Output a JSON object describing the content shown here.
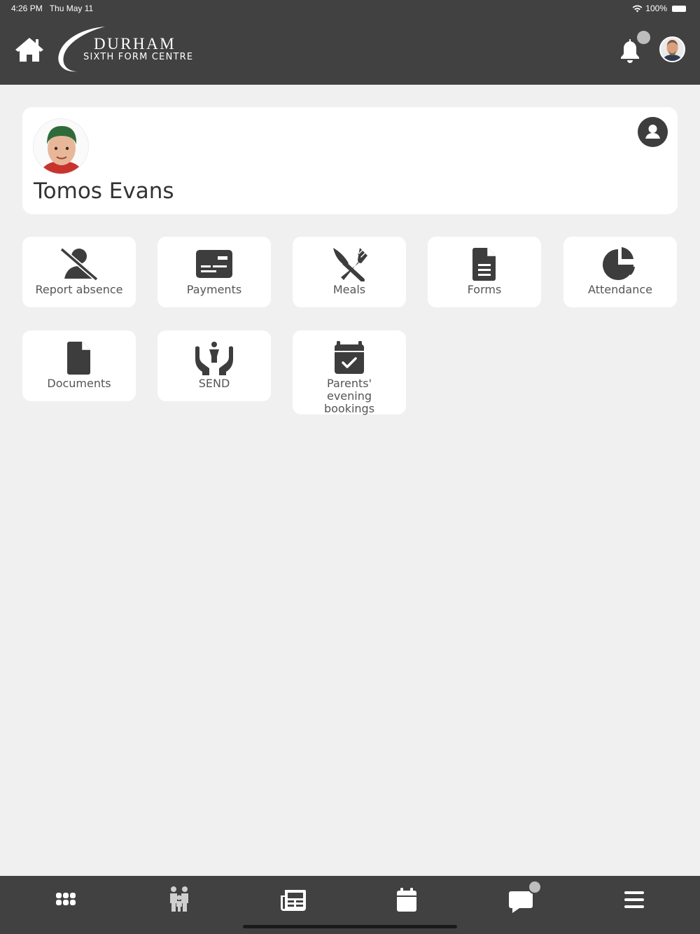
{
  "status_bar": {
    "time": "4:26 PM",
    "date": "Thu May 11",
    "battery": "100%"
  },
  "header": {
    "logo_title": "DURHAM",
    "logo_subtitle": "SIXTH FORM CENTRE",
    "icons": [
      "home-icon",
      "bell-icon",
      "user-avatar"
    ]
  },
  "profile": {
    "name": "Tomos Evans"
  },
  "tiles": [
    {
      "label": "Report absence",
      "icon": "user-slash-icon"
    },
    {
      "label": "Payments",
      "icon": "credit-card-icon"
    },
    {
      "label": "Meals",
      "icon": "utensils-icon"
    },
    {
      "label": "Forms",
      "icon": "document-text-icon"
    },
    {
      "label": "Attendance",
      "icon": "pie-chart-icon"
    },
    {
      "label": "Documents",
      "icon": "file-icon"
    },
    {
      "label": "SEND",
      "icon": "hands-holding-child-icon"
    },
    {
      "label": "Parents' evening bookings",
      "icon": "calendar-check-icon"
    }
  ],
  "bottom_nav": [
    "apps-grid-icon",
    "family-icon",
    "newspaper-icon",
    "calendar-icon",
    "chat-icon",
    "menu-icon"
  ],
  "colors": {
    "bar": "#414141",
    "background": "#f0f0f0",
    "card": "#ffffff",
    "icon": "#3d3d3d",
    "badge": "#bdbdbd"
  }
}
